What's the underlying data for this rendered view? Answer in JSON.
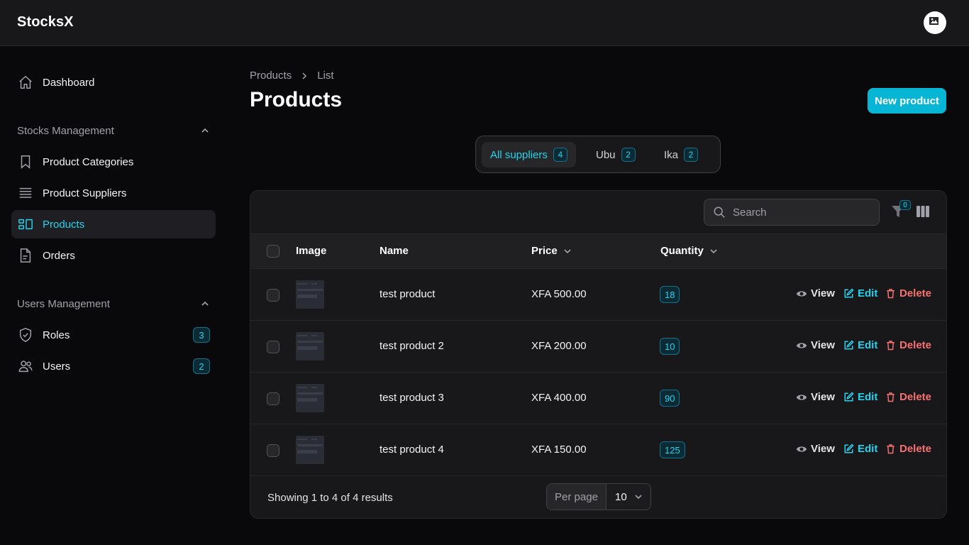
{
  "app": {
    "brand": "StocksX"
  },
  "sidebar": {
    "dashboard": "Dashboard",
    "groups": [
      {
        "label": "Stocks Management",
        "items": [
          "Product Categories",
          "Product Suppliers",
          "Products",
          "Orders"
        ]
      },
      {
        "label": "Users Management",
        "items": [
          "Roles",
          "Users"
        ]
      }
    ],
    "badges": {
      "roles": "3",
      "users": "2"
    },
    "active": "Products"
  },
  "breadcrumb": [
    "Products",
    "List"
  ],
  "page": {
    "title": "Products",
    "new_button": "New product"
  },
  "tabs": [
    {
      "label": "All suppliers",
      "count": "4",
      "active": true
    },
    {
      "label": "Ubu",
      "count": "2"
    },
    {
      "label": "Ika",
      "count": "2"
    }
  ],
  "table": {
    "search_placeholder": "Search",
    "filter_count": "0",
    "headers": {
      "image": "Image",
      "name": "Name",
      "price": "Price",
      "quantity": "Quantity"
    },
    "actions": {
      "view": "View",
      "edit": "Edit",
      "delete": "Delete"
    },
    "rows": [
      {
        "name": "test product",
        "price": "XFA 500.00",
        "quantity": "18"
      },
      {
        "name": "test product 2",
        "price": "XFA 200.00",
        "quantity": "10"
      },
      {
        "name": "test product 3",
        "price": "XFA 400.00",
        "quantity": "90"
      },
      {
        "name": "test product 4",
        "price": "XFA 150.00",
        "quantity": "125"
      }
    ],
    "footer": {
      "summary": "Showing 1 to 4 of 4 results",
      "per_page_label": "Per page",
      "per_page_value": "10"
    }
  },
  "colors": {
    "accent": "#06b6d4",
    "danger": "#f87171",
    "background": "#09090b",
    "surface": "#18181b"
  }
}
